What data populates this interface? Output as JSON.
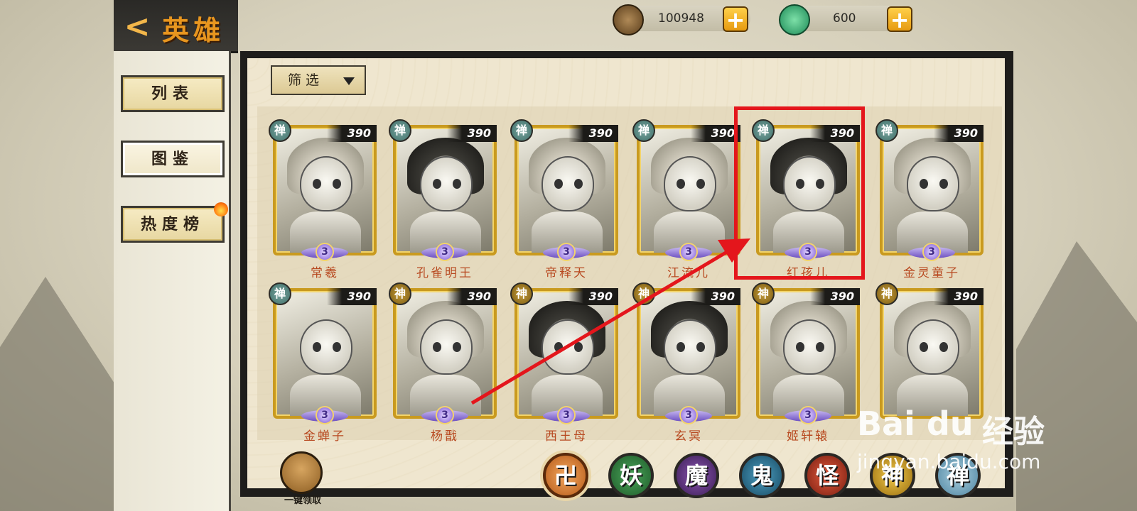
{
  "header": {
    "back_icon": "chevron-left",
    "title": "英雄"
  },
  "currency": [
    {
      "icon": "coin-stack-icon",
      "value": "100948"
    },
    {
      "icon": "jade-icon",
      "value": "600"
    }
  ],
  "sidebar": {
    "items": [
      {
        "label": "列表",
        "active": false
      },
      {
        "label": "图鉴",
        "active": true
      },
      {
        "label": "热度榜",
        "active": false
      }
    ]
  },
  "filter": {
    "label": "筛选"
  },
  "heroes": [
    {
      "name": "常羲",
      "faction": "禅",
      "level": "390",
      "star": "3"
    },
    {
      "name": "孔雀明王",
      "faction": "禅",
      "level": "390",
      "star": "3"
    },
    {
      "name": "帝释天",
      "faction": "禅",
      "level": "390",
      "star": "3"
    },
    {
      "name": "江流儿",
      "faction": "禅",
      "level": "390",
      "star": "3"
    },
    {
      "name": "红孩儿",
      "faction": "禅",
      "level": "390",
      "star": "3"
    },
    {
      "name": "金灵童子",
      "faction": "禅",
      "level": "390",
      "star": "3"
    },
    {
      "name": "金蝉子",
      "faction": "禅",
      "level": "390",
      "star": "3"
    },
    {
      "name": "杨戬",
      "faction": "神",
      "level": "390",
      "star": "3"
    },
    {
      "name": "西王母",
      "faction": "神",
      "level": "390",
      "star": "3"
    },
    {
      "name": "玄冥",
      "faction": "神",
      "level": "390",
      "star": "3"
    },
    {
      "name": "姬轩辕",
      "faction": "神",
      "level": "390",
      "star": "3"
    },
    {
      "name": "",
      "faction": "神",
      "level": "390",
      "star": ""
    }
  ],
  "bottom": {
    "claim_label": "一键领取",
    "factions": [
      "",
      "妖",
      "魔",
      "鬼",
      "怪",
      "神",
      "禅"
    ],
    "faction_colors": [
      "#e8823a",
      "#2f7a3c",
      "#5a2f7a",
      "#2a6f8e",
      "#b3341f",
      "#d2a020",
      "#5b8fa8"
    ]
  },
  "watermark": {
    "logo": "Bai du",
    "text": "经验",
    "url": "jingyan.baidu.com"
  },
  "annotation_color": "#e4161c"
}
